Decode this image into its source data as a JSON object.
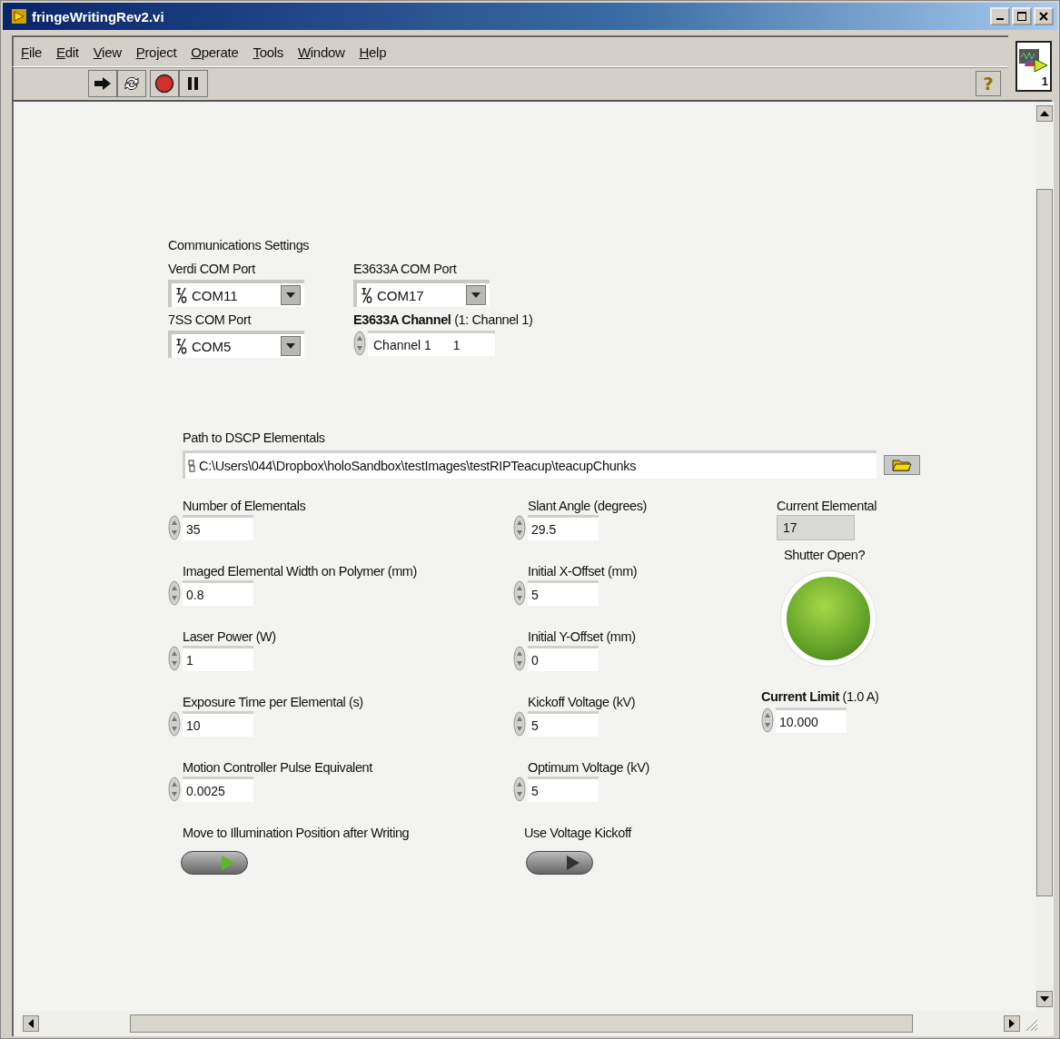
{
  "window": {
    "title": "fringeWritingRev2.vi"
  },
  "menu": [
    {
      "label": "File"
    },
    {
      "label": "Edit"
    },
    {
      "label": "View"
    },
    {
      "label": "Project"
    },
    {
      "label": "Operate"
    },
    {
      "label": "Tools"
    },
    {
      "label": "Window"
    },
    {
      "label": "Help"
    }
  ],
  "toolbar": {
    "help_button": "?",
    "connector_number": "1"
  },
  "communications": {
    "title": "Communications Settings",
    "ports": [
      {
        "label": "Verdi COM Port",
        "value": "COM11"
      },
      {
        "label": "E3633A COM Port",
        "value": "COM17"
      },
      {
        "label": "7SS COM Port",
        "value": "COM5"
      }
    ],
    "channel": {
      "label": "**E3633A Channel** (1: Channel 1)",
      "value": "Channel 1",
      "number": "1"
    }
  },
  "path": {
    "label": "Path to DSCP Elementals",
    "value": "C:\\Users\\044\\Dropbox\\holoSandbox\\testImages\\testRIPTeacup\\teacupChunks"
  },
  "column_1": [
    {
      "label": "Number of Elementals",
      "value": "35"
    },
    {
      "label": "Imaged Elemental Width on Polymer (mm)",
      "value": "0.8"
    },
    {
      "label": "Laser Power (W)",
      "value": "1"
    },
    {
      "label": "Exposure Time per Elemental (s)",
      "value": "10"
    },
    {
      "label": "Motion Controller Pulse Equivalent",
      "value": "0.0025"
    }
  ],
  "column_2": [
    {
      "label": "Slant Angle (degrees)",
      "value": "29.5"
    },
    {
      "label": "Initial X-Offset (mm)",
      "value": "5"
    },
    {
      "label": "Initial Y-Offset (mm)",
      "value": "0"
    },
    {
      "label": "Kickoff Voltage (kV)",
      "value": "5"
    },
    {
      "label": "Optimum Voltage (kV)",
      "value": "5"
    }
  ],
  "switches": [
    {
      "label": "Move to Illumination Position after Writing",
      "on": true
    },
    {
      "label": "Use Voltage Kickoff",
      "on": false
    }
  ],
  "current_elemental": {
    "label": "Current Elemental",
    "value": "17"
  },
  "shutter": {
    "label": "Shutter Open?",
    "on": true
  },
  "current_limit": {
    "label": "**Current Limit** (1.0 A)",
    "value": "10.000"
  }
}
